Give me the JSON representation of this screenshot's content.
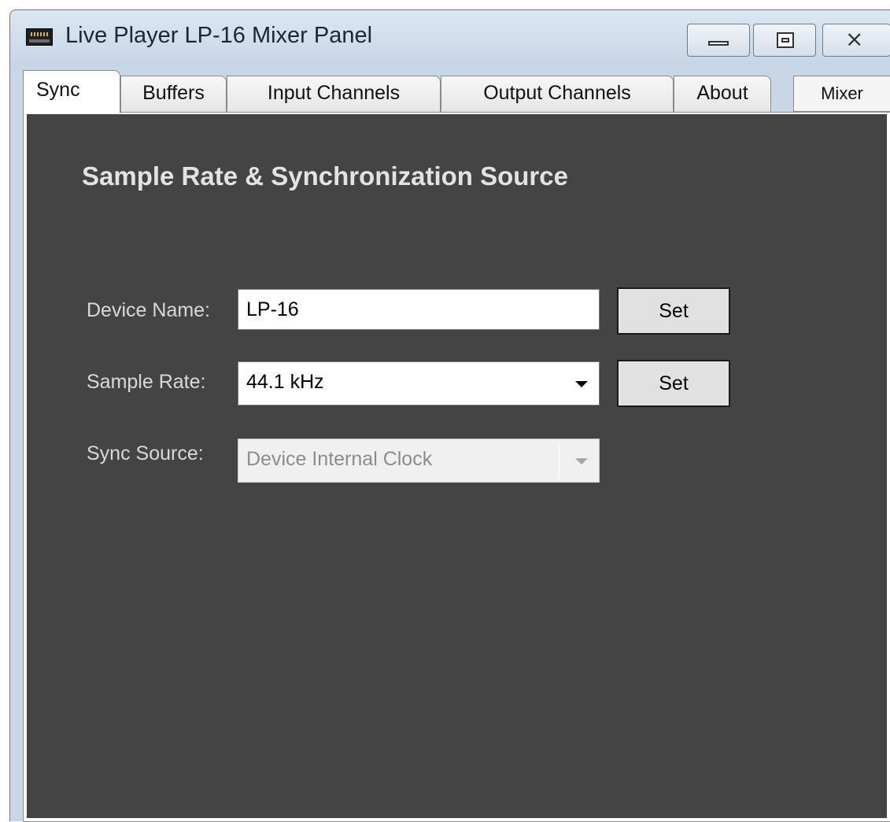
{
  "window": {
    "title": "Live Player LP-16 Mixer Panel",
    "icon": "mixer-device-icon",
    "controls": {
      "minimize": "minimize-icon",
      "maximize": "maximize-icon",
      "close": "close-icon",
      "close_glyph": "⨯"
    }
  },
  "tabs": [
    {
      "label": "Sync",
      "active": true
    },
    {
      "label": "Buffers",
      "active": false
    },
    {
      "label": "Input Channels",
      "active": false
    },
    {
      "label": "Output Channels",
      "active": false
    },
    {
      "label": "About",
      "active": false
    }
  ],
  "mixer_button": {
    "label": "Mixer"
  },
  "sync_panel": {
    "title": "Sample Rate & Synchronization Source",
    "device_name": {
      "label": "Device Name:",
      "value": "LP-16",
      "set_label": "Set"
    },
    "sample_rate": {
      "label": "Sample Rate:",
      "value": "44.1 kHz",
      "set_label": "Set"
    },
    "sync_source": {
      "label": "Sync Source:",
      "value": "Device Internal Clock",
      "enabled": false
    }
  },
  "colors": {
    "panel_background": "#444444",
    "title_bar": "#c8d6e5",
    "label_text": "#d9d9d9"
  }
}
